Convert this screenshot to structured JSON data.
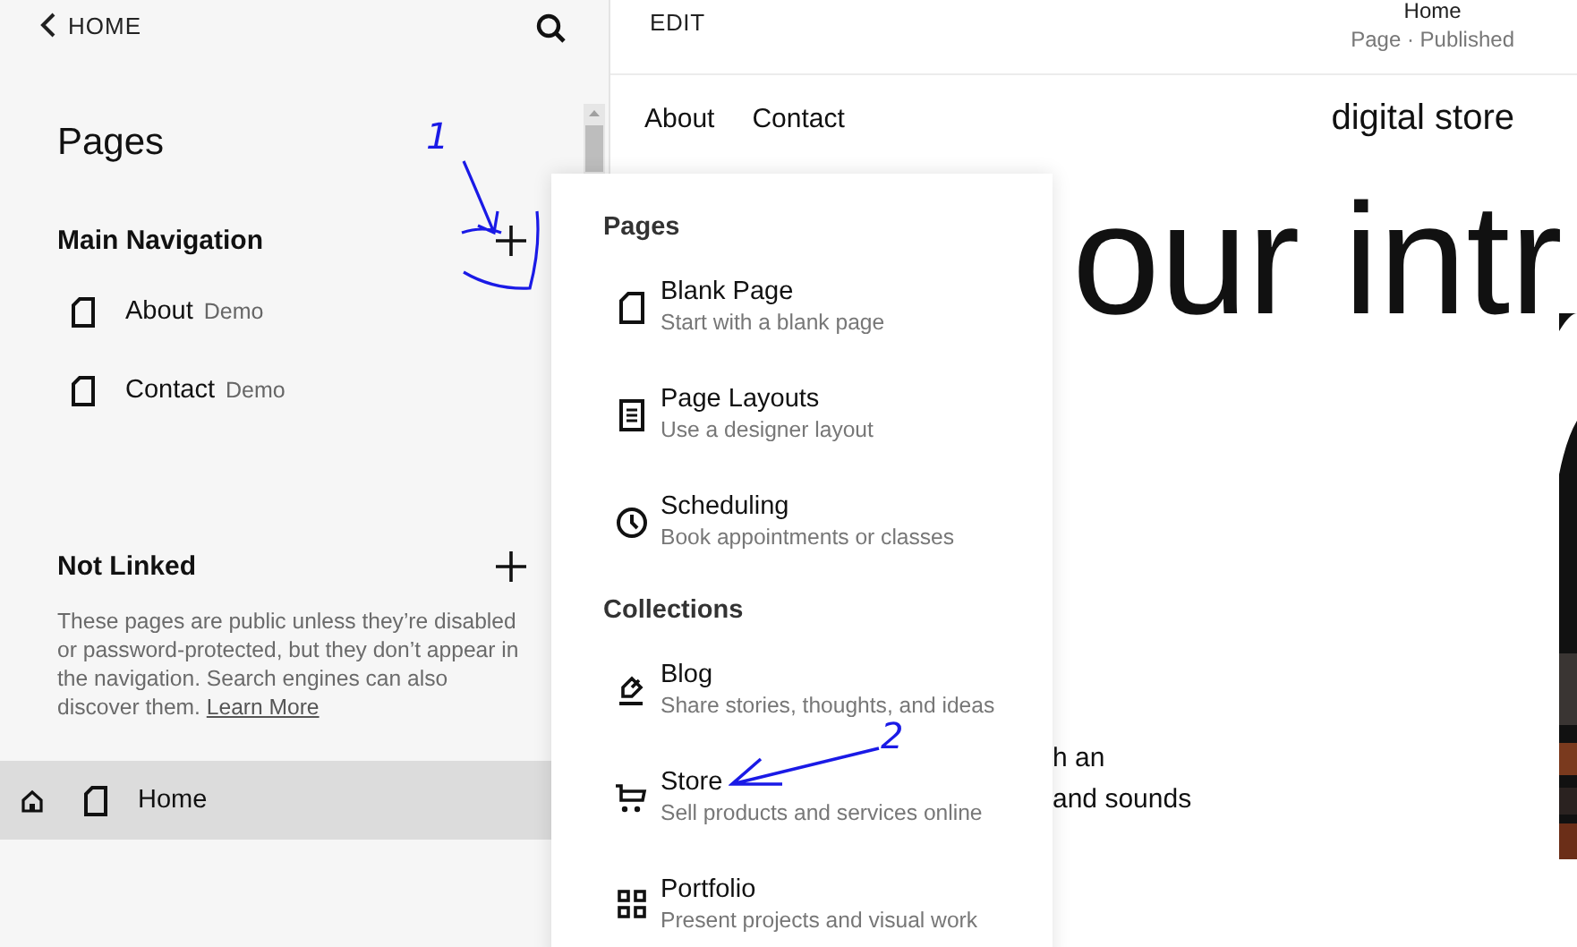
{
  "sidebar": {
    "back_label": "HOME",
    "title": "Pages",
    "sections": [
      {
        "heading": "Main Navigation",
        "pages": [
          {
            "label": "About",
            "tag": "Demo",
            "homepage": false,
            "selected": false
          },
          {
            "label": "Contact",
            "tag": "Demo",
            "homepage": false,
            "selected": false
          }
        ]
      },
      {
        "heading": "Not Linked",
        "description": "These pages are public unless they’re disabled or password-protected, but they don’t appear in the navigation. Search engines can also discover them.",
        "link": "Learn More",
        "pages": [
          {
            "label": "Home",
            "homepage": true,
            "selected": true
          }
        ]
      }
    ]
  },
  "preview": {
    "edit_label": "EDIT",
    "page_title": "Home",
    "page_status": "Page · Published",
    "nav_links": [
      "About",
      "Contact"
    ],
    "site_title": "digital store",
    "heading": "our intr",
    "body_lines": [
      "h an",
      "and sounds"
    ]
  },
  "add_menu": {
    "groups": [
      {
        "heading": "Pages",
        "items": [
          {
            "kind": "blank",
            "title": "Blank Page",
            "subtitle": "Start with a blank page"
          },
          {
            "kind": "layouts",
            "title": "Page Layouts",
            "subtitle": "Use a designer layout"
          },
          {
            "kind": "scheduling",
            "title": "Scheduling",
            "subtitle": "Book appointments or classes"
          }
        ]
      },
      {
        "heading": "Collections",
        "items": [
          {
            "kind": "blog",
            "title": "Blog",
            "subtitle": "Share stories, thoughts, and ideas"
          },
          {
            "kind": "store",
            "title": "Store",
            "subtitle": "Sell products and services online"
          },
          {
            "kind": "portfolio",
            "title": "Portfolio",
            "subtitle": "Present projects and visual work"
          }
        ]
      }
    ]
  },
  "annotations": [
    {
      "number": "1"
    },
    {
      "number": "2"
    }
  ]
}
